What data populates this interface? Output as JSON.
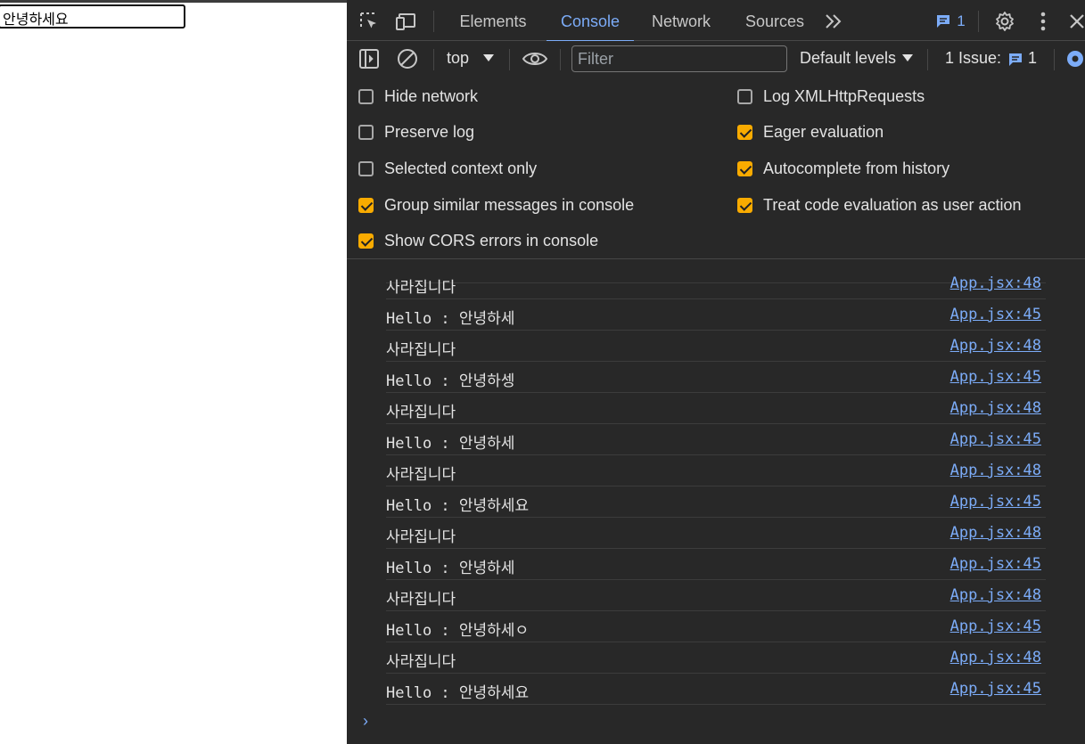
{
  "page": {
    "input_value": "안녕하세요"
  },
  "devtools": {
    "tabs": [
      "Elements",
      "Console",
      "Network",
      "Sources"
    ],
    "active_tab": "Console",
    "badge_count": "1",
    "toolbar": {
      "context": "top",
      "filter_placeholder": "Filter",
      "levels": "Default levels",
      "issues_label": "1 Issue:",
      "issues_count": "1"
    },
    "settings": {
      "left": [
        {
          "label": "Hide network",
          "checked": false
        },
        {
          "label": "Preserve log",
          "checked": false
        },
        {
          "label": "Selected context only",
          "checked": false
        },
        {
          "label": "Group similar messages in console",
          "checked": true
        },
        {
          "label": "Show CORS errors in console",
          "checked": true
        }
      ],
      "right": [
        {
          "label": "Log XMLHttpRequests",
          "checked": false
        },
        {
          "label": "Eager evaluation",
          "checked": true
        },
        {
          "label": "Autocomplete from history",
          "checked": true
        },
        {
          "label": "Treat code evaluation as user action",
          "checked": true
        }
      ]
    },
    "console_rows": [
      {
        "msg": "사라집니다",
        "src": "App.jsx:48"
      },
      {
        "msg": "Hello : 안녕하세",
        "src": "App.jsx:45"
      },
      {
        "msg": "사라집니다",
        "src": "App.jsx:48"
      },
      {
        "msg": "Hello : 안녕하셍",
        "src": "App.jsx:45"
      },
      {
        "msg": "사라집니다",
        "src": "App.jsx:48"
      },
      {
        "msg": "Hello : 안녕하세",
        "src": "App.jsx:45"
      },
      {
        "msg": "사라집니다",
        "src": "App.jsx:48"
      },
      {
        "msg": "Hello : 안녕하세요",
        "src": "App.jsx:45"
      },
      {
        "msg": "사라집니다",
        "src": "App.jsx:48"
      },
      {
        "msg": "Hello : 안녕하세",
        "src": "App.jsx:45"
      },
      {
        "msg": "사라집니다",
        "src": "App.jsx:48"
      },
      {
        "msg": "Hello : 안녕하세ㅇ",
        "src": "App.jsx:45"
      },
      {
        "msg": "사라집니다",
        "src": "App.jsx:48"
      },
      {
        "msg": "Hello : 안녕하세요",
        "src": "App.jsx:45"
      }
    ],
    "colors": {
      "accent": "#7cacf8",
      "checkbox_on": "#f9ab00",
      "panel_bg": "#282828"
    }
  }
}
